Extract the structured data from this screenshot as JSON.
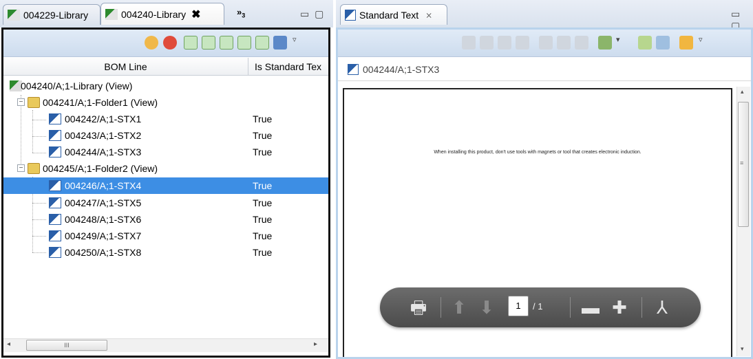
{
  "left_panel": {
    "tabs": [
      {
        "label": "004229-Library"
      },
      {
        "label": "004240-Library",
        "close": "✖"
      }
    ],
    "overflow": {
      "label": "»",
      "count": "3"
    },
    "minmax": "▭ ▢",
    "columns": {
      "bom_line": "BOM Line",
      "is_standard_text": "Is Standard Tex"
    },
    "rows": [
      {
        "label": "004240/A;1-Library (View)",
        "value": ""
      },
      {
        "label": "004241/A;1-Folder1 (View)",
        "value": ""
      },
      {
        "label": "004242/A;1-STX1",
        "value": "True"
      },
      {
        "label": "004243/A;1-STX2",
        "value": "True"
      },
      {
        "label": "004244/A;1-STX3",
        "value": "True"
      },
      {
        "label": "004245/A;1-Folder2 (View)",
        "value": ""
      },
      {
        "label": "004246/A;1-STX4",
        "value": "True"
      },
      {
        "label": "004247/A;1-STX5",
        "value": "True"
      },
      {
        "label": "004248/A;1-STX6",
        "value": "True"
      },
      {
        "label": "004249/A;1-STX7",
        "value": "True"
      },
      {
        "label": "004250/A;1-STX8",
        "value": "True"
      }
    ],
    "expander_minus": "−",
    "hscroll": {
      "left": "◂",
      "grip": "III",
      "right": "▸"
    }
  },
  "right_panel": {
    "tab": {
      "label": "Standard Text",
      "close": "⨯"
    },
    "minmax": "▭ ▢",
    "title": "004244/A;1-STX3",
    "document_text": "When installing this product, don't use tools with magnets or tool that creates electronic induction.",
    "vscroll": {
      "up": "▴",
      "grip": "≡",
      "down": "▾"
    },
    "pdf_toolbar": {
      "print": "🖶",
      "prev": "⬆",
      "next": "⬇",
      "page": "1",
      "of": "/ 1",
      "zoom_out": "▬",
      "zoom_in": "✚",
      "acrobat": "⅄"
    }
  }
}
